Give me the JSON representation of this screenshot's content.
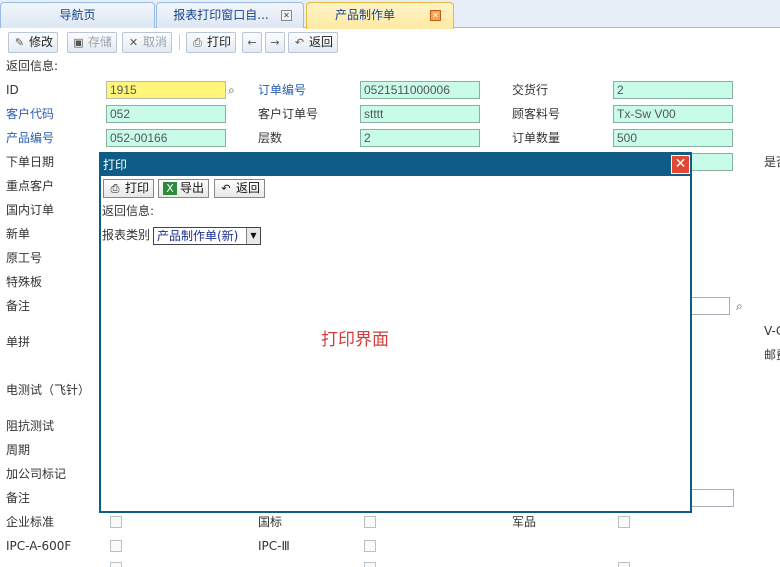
{
  "tabs": [
    {
      "label": "导航页"
    },
    {
      "label": "报表打印窗口自..."
    },
    {
      "label": "产品制作单"
    }
  ],
  "toolbar": {
    "edit": "修改",
    "save": "存储",
    "cancel": "取消",
    "print": "打印",
    "back": "返回"
  },
  "form": {
    "return_info": "返回信息:",
    "id_label": "ID",
    "id_value": "1915",
    "order_no_label": "订单编号",
    "order_no_value": "0521511000006",
    "delivery_label": "交货行",
    "delivery_value": "2",
    "cust_code_label": "客户代码",
    "cust_code_value": "052",
    "cust_order_label": "客户订单号",
    "cust_order_value": "stttt",
    "cust_material_label": "顾客料号",
    "cust_material_value": "Tx-Sw V00",
    "product_no_label": "产品编号",
    "product_no_value": "052-00166",
    "layers_label": "层数",
    "layers_value": "2",
    "qty_label": "订单数量",
    "qty_value": "500",
    "order_date_label": "下单日期",
    "vip_label": "重点客户",
    "domestic_label": "国内订单",
    "new_label": "新单",
    "original_job_label": "原工号",
    "special_board_label": "特殊板",
    "remark_label": "备注",
    "panel_label": "单拼",
    "etest_label": "电测试（飞针）",
    "impedance_label": "阻抗测试",
    "period_label": "周期",
    "company_mark_label": "加公司标记",
    "remark2_label": "备注",
    "enterprise_std_label": "企业标准",
    "national_std_label": "国标",
    "military_label": "军品",
    "ipc_a_label": "IPC-A-600F",
    "ipc_3_label": "IPC-Ⅲ",
    "right_partial_1": "是否",
    "right_partial_2": "V-C",
    "right_partial_3": "邮费"
  },
  "dialog": {
    "title": "打印",
    "print_btn": "打印",
    "export_btn": "导出",
    "back_btn": "返回",
    "return_info": "返回信息:",
    "report_type_label": "报表类别",
    "report_type_value": "产品制作单(新)",
    "center_text": "打印界面"
  }
}
